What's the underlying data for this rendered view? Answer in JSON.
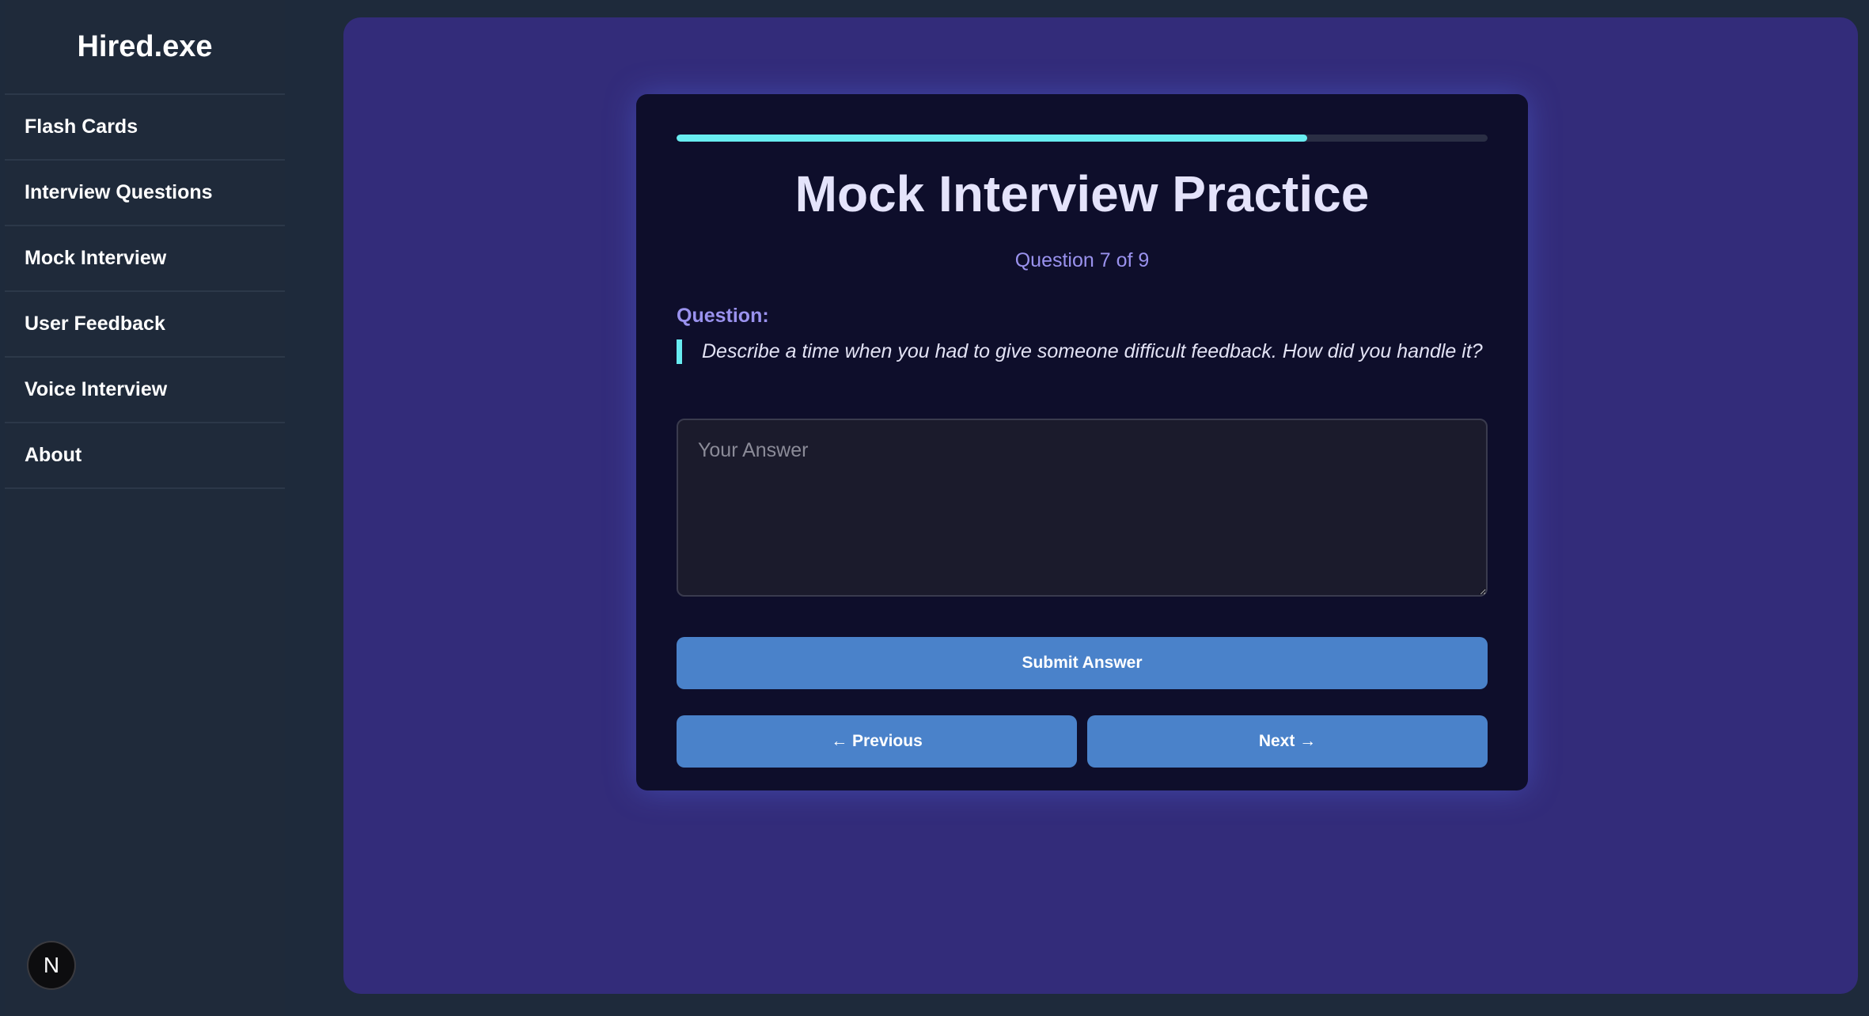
{
  "app": {
    "title": "Hired.exe"
  },
  "sidebar": {
    "items": [
      {
        "label": "Flash Cards"
      },
      {
        "label": "Interview Questions"
      },
      {
        "label": "Mock Interview"
      },
      {
        "label": "User Feedback"
      },
      {
        "label": "Voice Interview"
      },
      {
        "label": "About"
      }
    ]
  },
  "badge": {
    "label": "N"
  },
  "interview": {
    "title": "Mock Interview Practice",
    "counter": "Question 7 of 9",
    "progress_fraction": 0.778,
    "question_label": "Question:",
    "question_text": "Describe a time when you had to give someone difficult feedback. How did you handle it?",
    "answer_value": "",
    "answer_placeholder": "Your Answer",
    "submit_label": "Submit Answer",
    "previous_label": "← Previous",
    "next_label": "Next →"
  },
  "colors": {
    "accent": "#68ecf1",
    "button": "#4a82ca",
    "main_bg": "#332c7a",
    "card_bg": "#0e0e2b",
    "sidebar_bg": "#1f2a3a",
    "label_purple": "#9a92ee"
  }
}
